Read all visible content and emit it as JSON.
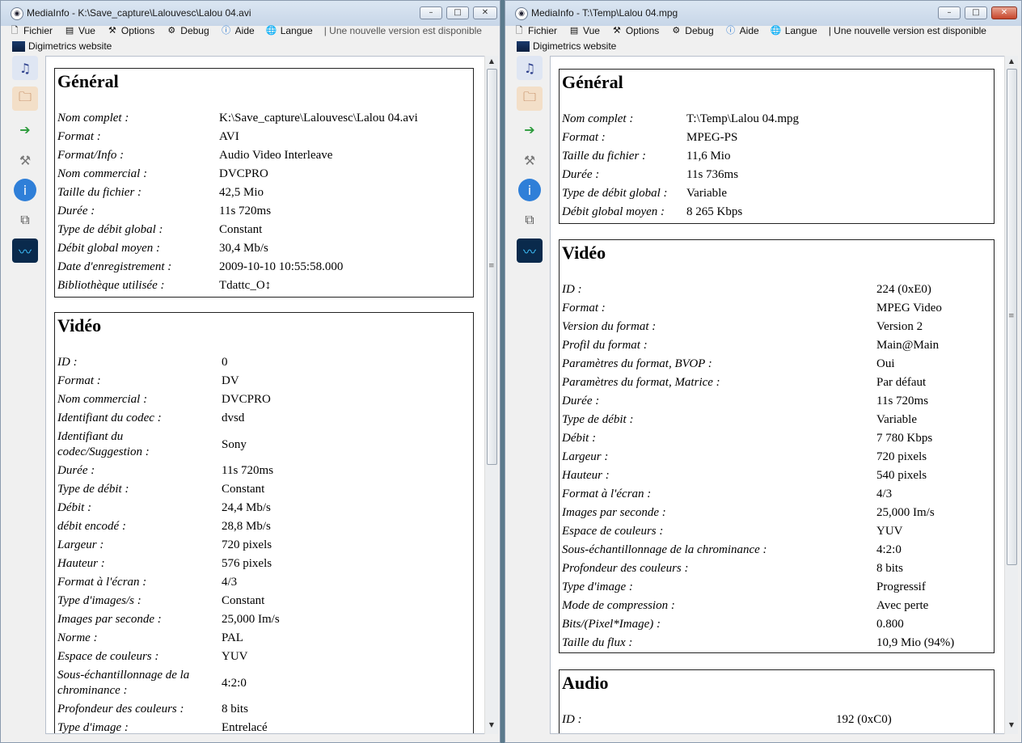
{
  "left": {
    "title": "MediaInfo - K:\\Save_capture\\Lalouvesc\\Lalou 04.avi",
    "menu": [
      "Fichier",
      "Vue",
      "Options",
      "Debug",
      "Aide",
      "Langue"
    ],
    "notice": "| Une nouvelle version est disponible",
    "link": "Digimetrics website",
    "general_title": "Général",
    "general": [
      {
        "k": "Nom complet :",
        "v": "K:\\Save_capture\\Lalouvesc\\Lalou 04.avi"
      },
      {
        "k": "Format :",
        "v": "AVI"
      },
      {
        "k": "Format/Info :",
        "v": "Audio Video Interleave"
      },
      {
        "k": "Nom commercial :",
        "v": "DVCPRO"
      },
      {
        "k": "Taille du fichier :",
        "v": "42,5 Mio"
      },
      {
        "k": "Durée :",
        "v": "11s 720ms"
      },
      {
        "k": "Type de débit global :",
        "v": "Constant"
      },
      {
        "k": "Débit global moyen :",
        "v": "30,4 Mb/s"
      },
      {
        "k": "Date d'enregistrement :",
        "v": "2009-10-10 10:55:58.000"
      },
      {
        "k": "Bibliothèque utilisée :",
        "v": "Tdattc_O↕"
      }
    ],
    "video_title": "Vidéo",
    "video": [
      {
        "k": "ID :",
        "v": "0"
      },
      {
        "k": "Format :",
        "v": "DV"
      },
      {
        "k": "Nom commercial :",
        "v": "DVCPRO"
      },
      {
        "k": "Identifiant du codec :",
        "v": "dvsd"
      },
      {
        "k": "Identifiant du codec/Suggestion :",
        "v": "Sony"
      },
      {
        "k": "Durée :",
        "v": "11s 720ms"
      },
      {
        "k": "Type de débit :",
        "v": "Constant"
      },
      {
        "k": "Débit :",
        "v": "24,4 Mb/s"
      },
      {
        "k": "débit encodé :",
        "v": "28,8 Mb/s"
      },
      {
        "k": "Largeur :",
        "v": "720 pixels"
      },
      {
        "k": "Hauteur :",
        "v": "576 pixels"
      },
      {
        "k": "Format à l'écran :",
        "v": "4/3"
      },
      {
        "k": "Type d'images/s :",
        "v": "Constant"
      },
      {
        "k": "Images par seconde :",
        "v": "25,000 Im/s"
      },
      {
        "k": "Norme :",
        "v": "PAL"
      },
      {
        "k": "Espace de couleurs :",
        "v": "YUV"
      },
      {
        "k": "Sous-échantillonnage de la chrominance :",
        "v": "4:2:0"
      },
      {
        "k": "Profondeur des couleurs :",
        "v": "8 bits"
      },
      {
        "k": "Type d'image :",
        "v": "Entrelacé"
      }
    ]
  },
  "right": {
    "title": "MediaInfo - T:\\Temp\\Lalou 04.mpg",
    "menu": [
      "Fichier",
      "Vue",
      "Options",
      "Debug",
      "Aide",
      "Langue"
    ],
    "notice": "| Une nouvelle version est disponible",
    "link": "Digimetrics website",
    "general_title": "Général",
    "general": [
      {
        "k": "Nom complet :",
        "v": "T:\\Temp\\Lalou 04.mpg"
      },
      {
        "k": "Format :",
        "v": "MPEG-PS"
      },
      {
        "k": "Taille du fichier :",
        "v": "11,6 Mio"
      },
      {
        "k": "Durée :",
        "v": "11s 736ms"
      },
      {
        "k": "Type de débit global :",
        "v": "Variable"
      },
      {
        "k": "Débit global moyen :",
        "v": "8 265 Kbps"
      }
    ],
    "video_title": "Vidéo",
    "video": [
      {
        "k": "ID :",
        "v": "224 (0xE0)"
      },
      {
        "k": "Format :",
        "v": "MPEG Video"
      },
      {
        "k": "Version du format :",
        "v": "Version 2"
      },
      {
        "k": "Profil du format :",
        "v": "Main@Main"
      },
      {
        "k": "Paramètres du format, BVOP :",
        "v": "Oui"
      },
      {
        "k": "Paramètres du format, Matrice :",
        "v": "Par défaut"
      },
      {
        "k": "Durée :",
        "v": "11s 720ms"
      },
      {
        "k": "Type de débit :",
        "v": "Variable"
      },
      {
        "k": "Débit :",
        "v": "7 780 Kbps"
      },
      {
        "k": "Largeur :",
        "v": "720 pixels"
      },
      {
        "k": "Hauteur :",
        "v": "540 pixels"
      },
      {
        "k": "Format à l'écran :",
        "v": "4/3"
      },
      {
        "k": "Images par seconde :",
        "v": "25,000 Im/s"
      },
      {
        "k": "Espace de couleurs :",
        "v": "YUV"
      },
      {
        "k": "Sous-échantillonnage de la chrominance :",
        "v": "4:2:0"
      },
      {
        "k": "Profondeur des couleurs :",
        "v": "8 bits"
      },
      {
        "k": "Type d'image :",
        "v": "Progressif"
      },
      {
        "k": "Mode de compression :",
        "v": "Avec perte"
      },
      {
        "k": "Bits/(Pixel*Image) :",
        "v": "0.800"
      },
      {
        "k": "Taille du flux :",
        "v": "10,9 Mio (94%)"
      }
    ],
    "audio_title": "Audio",
    "audio": [
      {
        "k": "ID :",
        "v": "192 (0xC0)"
      }
    ]
  }
}
